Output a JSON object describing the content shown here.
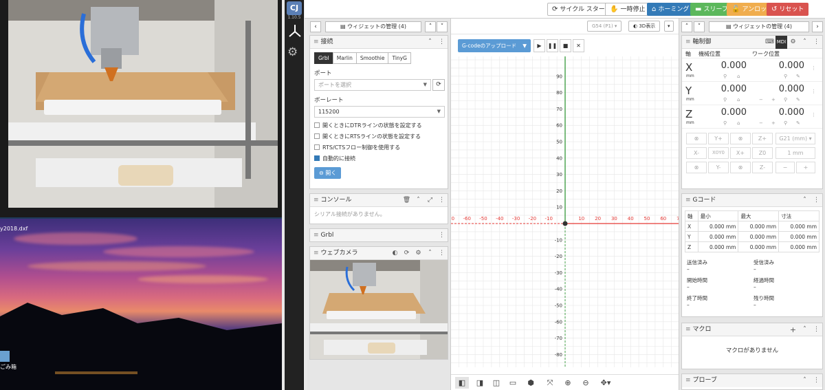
{
  "desktop": {
    "file_label": "y2018.dxf",
    "trash_label": "ごみ箱"
  },
  "sidebar": {
    "logo": "CJ",
    "version": "1.10.5"
  },
  "topbar": {
    "cycle_start": "サイクル スタート",
    "pause": "一時停止",
    "homing": "ホーミング",
    "sleep": "スリープ",
    "unlock": "アンロック",
    "reset": "リセット"
  },
  "left_column": {
    "manager": "ウィジェットの管理 (4)",
    "connection": {
      "title": "接続",
      "tabs": [
        "Grbl",
        "Marlin",
        "Smoothie",
        "TinyG"
      ],
      "port_label": "ポート",
      "port_placeholder": "ポートを選択",
      "baud_label": "ボーレート",
      "baud_value": "115200",
      "options": [
        {
          "label": "開くときにDTRラインの状態を設定する",
          "checked": false
        },
        {
          "label": "開くときにRTSラインの状態を設定する",
          "checked": false
        },
        {
          "label": "RTS/CTSフロー制御を使用する",
          "checked": false
        },
        {
          "label": "自動的に接続",
          "checked": true
        }
      ],
      "open_button": "開く"
    },
    "console": {
      "title": "コンソール",
      "empty": "シリアル接続がありません。"
    },
    "grbl": {
      "title": "Grbl"
    },
    "webcam": {
      "title": "ウェブカメラ"
    }
  },
  "center": {
    "wcs": "G54 (P1)",
    "view3d": "3D表示",
    "upload": "G-codeのアップロード"
  },
  "right_column": {
    "manager": "ウィジェットの管理 (4)",
    "axes": {
      "title": "軸制御",
      "mdi": "MDI",
      "machine_pos": "機械位置",
      "work_pos": "ワーク位置",
      "rows": [
        {
          "axis": "X",
          "unit": "mm",
          "machine": "0.000",
          "work": "0.000"
        },
        {
          "axis": "Y",
          "unit": "mm",
          "machine": "0.000",
          "work": "0.000"
        },
        {
          "axis": "Z",
          "unit": "mm",
          "machine": "0.000",
          "work": "0.000"
        }
      ],
      "jog": {
        "row1": [
          "⊗",
          "Y+",
          "⊗",
          "Z+"
        ],
        "row2": [
          "X-",
          "X0Y0",
          "X+",
          "Z0"
        ],
        "row3": [
          "⊗",
          "Y-",
          "⊗",
          "Z-"
        ],
        "units": "G21 (mm)",
        "step": "1",
        "step_unit": "mm"
      }
    },
    "gcode": {
      "title": "Gコード",
      "headers": [
        "軸",
        "最小",
        "最大",
        "寸法"
      ],
      "rows": [
        [
          "X",
          "0.000 mm",
          "0.000 mm",
          "0.000 mm"
        ],
        [
          "Y",
          "0.000 mm",
          "0.000 mm",
          "0.000 mm"
        ],
        [
          "Z",
          "0.000 mm",
          "0.000 mm",
          "0.000 mm"
        ]
      ],
      "sent_label": "送信済み",
      "sent": "–",
      "received_label": "受信済み",
      "received": "–",
      "start_label": "開始時間",
      "start": "–",
      "elapsed_label": "経過時間",
      "elapsed": "–",
      "end_label": "終了時間",
      "end": "–",
      "remaining_label": "残り時間",
      "remaining": "–"
    },
    "macro": {
      "title": "マクロ",
      "empty": "マクロがありません"
    },
    "probe": {
      "title": "プローブ"
    }
  },
  "colors": {
    "accent_blue": "#337ab7",
    "homing": "#337ab7",
    "sleep": "#5cb85c",
    "unlock": "#f0ad4e",
    "reset": "#d9534f",
    "x_axis": "#e53935",
    "y_axis": "#43a047"
  }
}
